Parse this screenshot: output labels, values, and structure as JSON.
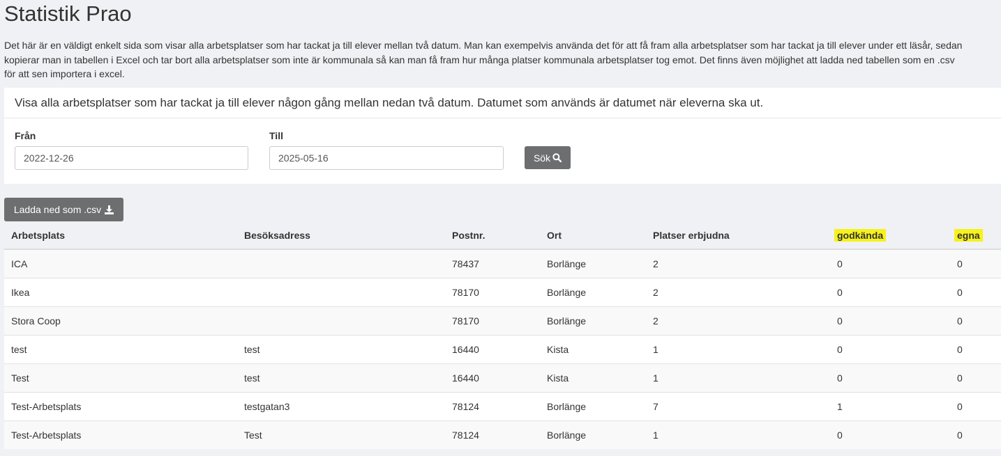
{
  "page": {
    "title": "Statistik Prao",
    "intro": [
      "Det här är en väldigt enkelt sida som visar alla arbetsplatser som har tackat ja till elever mellan två datum. Man kan exempelvis använda det för att få fram alla arbetsplatser som har tackat ja till elever under ett läsår, sedan",
      "kopierar man in tabellen i Excel och tar bort alla arbetsplatser som inte är kommunala så kan man få fram hur många platser kommunala arbetsplatser tog emot. Det finns även möjlighet att ladda ned tabellen som en .csv",
      "för att sen importera i excel."
    ]
  },
  "filter": {
    "heading": "Visa alla arbetsplatser som har tackat ja till elever någon gång mellan nedan två datum. Datumet som används är datumet när eleverna ska ut.",
    "from_label": "Från",
    "from_value": "2022-12-26",
    "to_label": "Till",
    "to_value": "2025-05-16",
    "search_label": "Sök",
    "search_icon": "search-icon"
  },
  "download": {
    "label": "Ladda ned som .csv",
    "icon": "download-icon"
  },
  "table": {
    "headers": [
      "Arbetsplats",
      "Besöksadress",
      "Postnr.",
      "Ort",
      "Platser erbjudna",
      "godkända",
      "egna"
    ],
    "highlight_color": "#f6f21b",
    "rows": [
      [
        "ICA",
        "",
        "78437",
        "Borlänge",
        "2",
        "0",
        "0"
      ],
      [
        "Ikea",
        "",
        "78170",
        "Borlänge",
        "2",
        "0",
        "0"
      ],
      [
        "Stora Coop",
        "",
        "78170",
        "Borlänge",
        "2",
        "0",
        "0"
      ],
      [
        "test",
        "test",
        "16440",
        "Kista",
        "1",
        "0",
        "0"
      ],
      [
        "Test",
        "test",
        "16440",
        "Kista",
        "1",
        "0",
        "0"
      ],
      [
        "Test-Arbetsplats",
        "testgatan3",
        "78124",
        "Borlänge",
        "7",
        "1",
        "0"
      ],
      [
        "Test-Arbetsplats",
        "Test",
        "78124",
        "Borlänge",
        "1",
        "0",
        "0"
      ]
    ]
  }
}
